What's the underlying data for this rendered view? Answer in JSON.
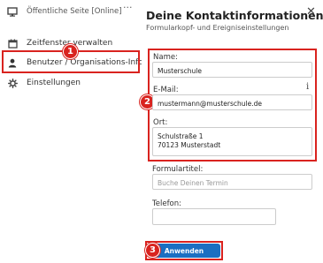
{
  "sidebar": {
    "top_item": {
      "label": "Öffentliche Seite [Online]",
      "icon": "monitor-icon"
    },
    "menu_dots": "···",
    "items": [
      {
        "label": "Zeitfenster verwalten",
        "icon": "calendar-icon"
      },
      {
        "label": "Benutzer / Organisations-Infor…",
        "icon": "user-icon"
      },
      {
        "label": "Einstellungen",
        "icon": "gear-icon"
      }
    ]
  },
  "panel": {
    "title": "Deine Kontaktinformationen",
    "subtitle": "Formularkopf- und Ereigniseinstellungen",
    "close_icon": "close-icon",
    "fields": {
      "name": {
        "label": "Name:",
        "value": "Musterschule"
      },
      "email": {
        "label": "E-Mail:",
        "value": "mustermann@musterschule.de",
        "info_icon": "i"
      },
      "ort": {
        "label": "Ort:",
        "value": "Schulstraße 1\n70123 Musterstadt"
      },
      "formulartitel": {
        "label": "Formulartitel:",
        "placeholder": "Buche Deinen Termin"
      },
      "telefon": {
        "label": "Telefon:",
        "value": ""
      }
    },
    "apply_label": "Anwenden"
  },
  "annotations": {
    "badges": [
      "1",
      "2",
      "3"
    ],
    "highlight_color": "#d9231f"
  },
  "colors": {
    "primary_button": "#1b6fc2"
  }
}
